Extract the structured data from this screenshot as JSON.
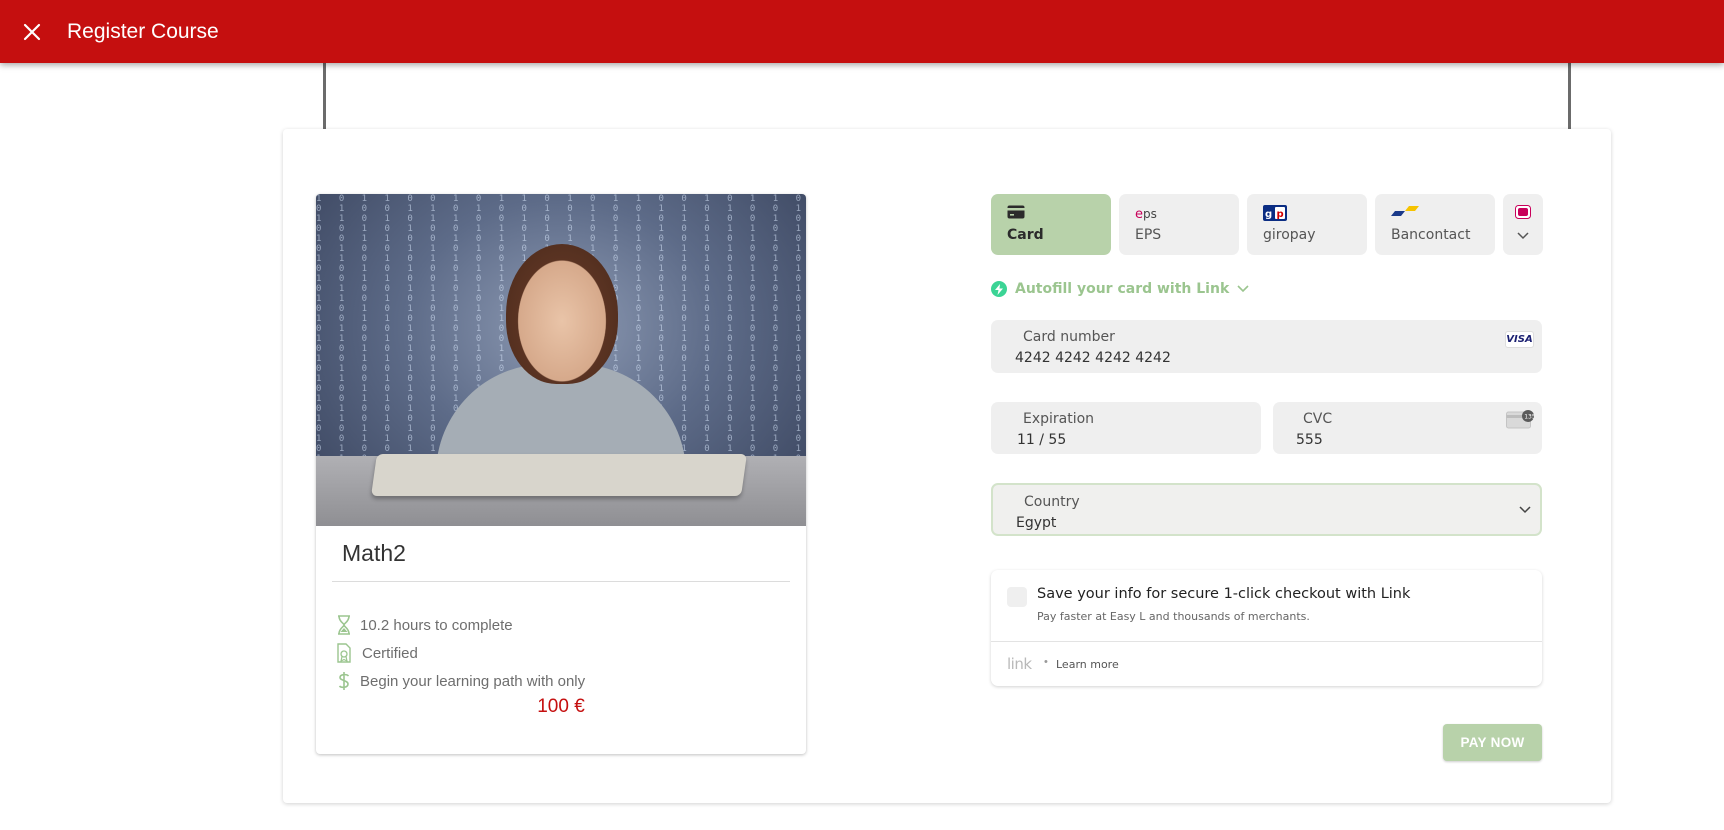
{
  "header": {
    "title": "Register Course",
    "close_icon": "close-icon"
  },
  "course": {
    "name": "Math2",
    "duration": "10.2 hours to complete",
    "certificate": "Certified",
    "offer": "Begin your learning path with only",
    "price": "100 €"
  },
  "payment": {
    "tabs": [
      {
        "label": "Card",
        "icon": "card-icon",
        "active": true
      },
      {
        "label": "EPS",
        "icon": "eps-icon",
        "active": false
      },
      {
        "label": "giropay",
        "icon": "giropay-icon",
        "active": false
      },
      {
        "label": "Bancontact",
        "icon": "bancontact-icon",
        "active": false
      }
    ],
    "autofill": "Autofill your card with Link",
    "card_number": {
      "label": "Card number",
      "value": "4242 4242 4242 4242",
      "brand": "VISA"
    },
    "expiration": {
      "label": "Expiration",
      "value": "11 / 55"
    },
    "cvc": {
      "label": "CVC",
      "value": "555"
    },
    "country": {
      "label": "Country",
      "value": "Egypt"
    },
    "link": {
      "save_text": "Save your info for secure 1-click checkout with Link",
      "sub_text": "Pay faster at Easy L and thousands of merchants.",
      "logo": "link",
      "dot": "•",
      "learn_more": "Learn more"
    },
    "pay_button": "PAY NOW"
  },
  "colors": {
    "topbar": "#c50f0f",
    "accent_green": "#b8d2aa",
    "price": "#c50f0f"
  }
}
